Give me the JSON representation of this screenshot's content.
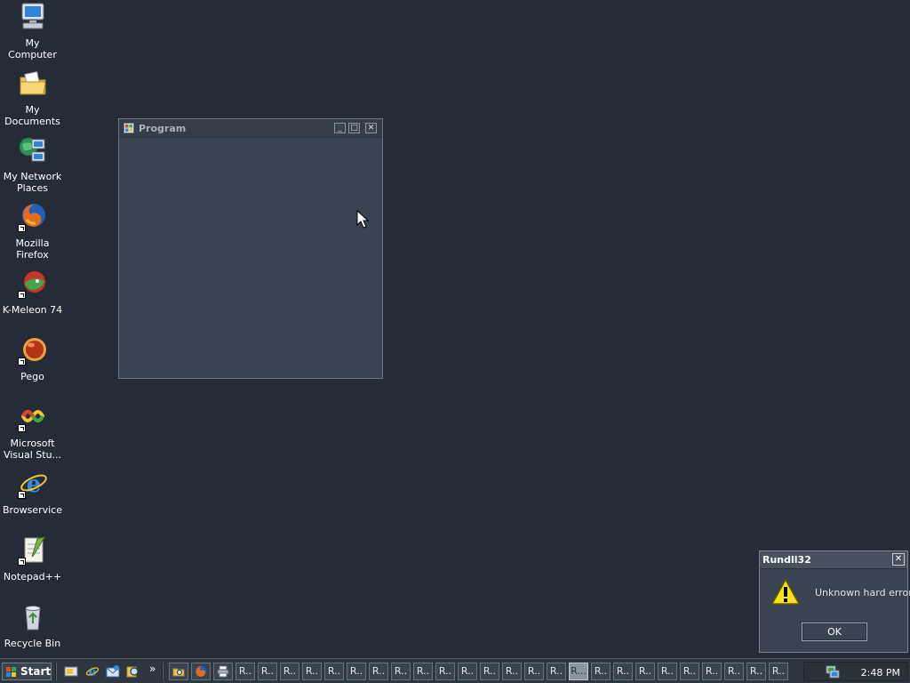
{
  "desktop": {
    "icons": [
      {
        "label": "My Computer"
      },
      {
        "label": "My Documents"
      },
      {
        "label": "My Network Places"
      },
      {
        "label": "Mozilla Firefox"
      },
      {
        "label": "K-Meleon 74"
      },
      {
        "label": "Pego"
      },
      {
        "label": "Microsoft Visual Stu..."
      },
      {
        "label": "Browservice"
      },
      {
        "label": "Notepad++"
      },
      {
        "label": "Recycle Bin"
      }
    ]
  },
  "program_window": {
    "title": "Program",
    "minimize_glyph": "_",
    "maximize_glyph": "□",
    "close_glyph": "✕"
  },
  "error_dialog": {
    "title": "Rundll32",
    "message": "Unknown hard error",
    "ok_label": "OK",
    "close_glyph": "✕"
  },
  "taskbar": {
    "start_label": "Start",
    "chevron": "»",
    "task_label": "R..",
    "active_task_label": "R...",
    "clock": "2:48 PM"
  },
  "colors": {
    "desktop_bg": "#252c37",
    "window_bg": "#3a4450",
    "taskbar_bg": "#2e3640",
    "warning_yellow": "#f7e21a"
  }
}
